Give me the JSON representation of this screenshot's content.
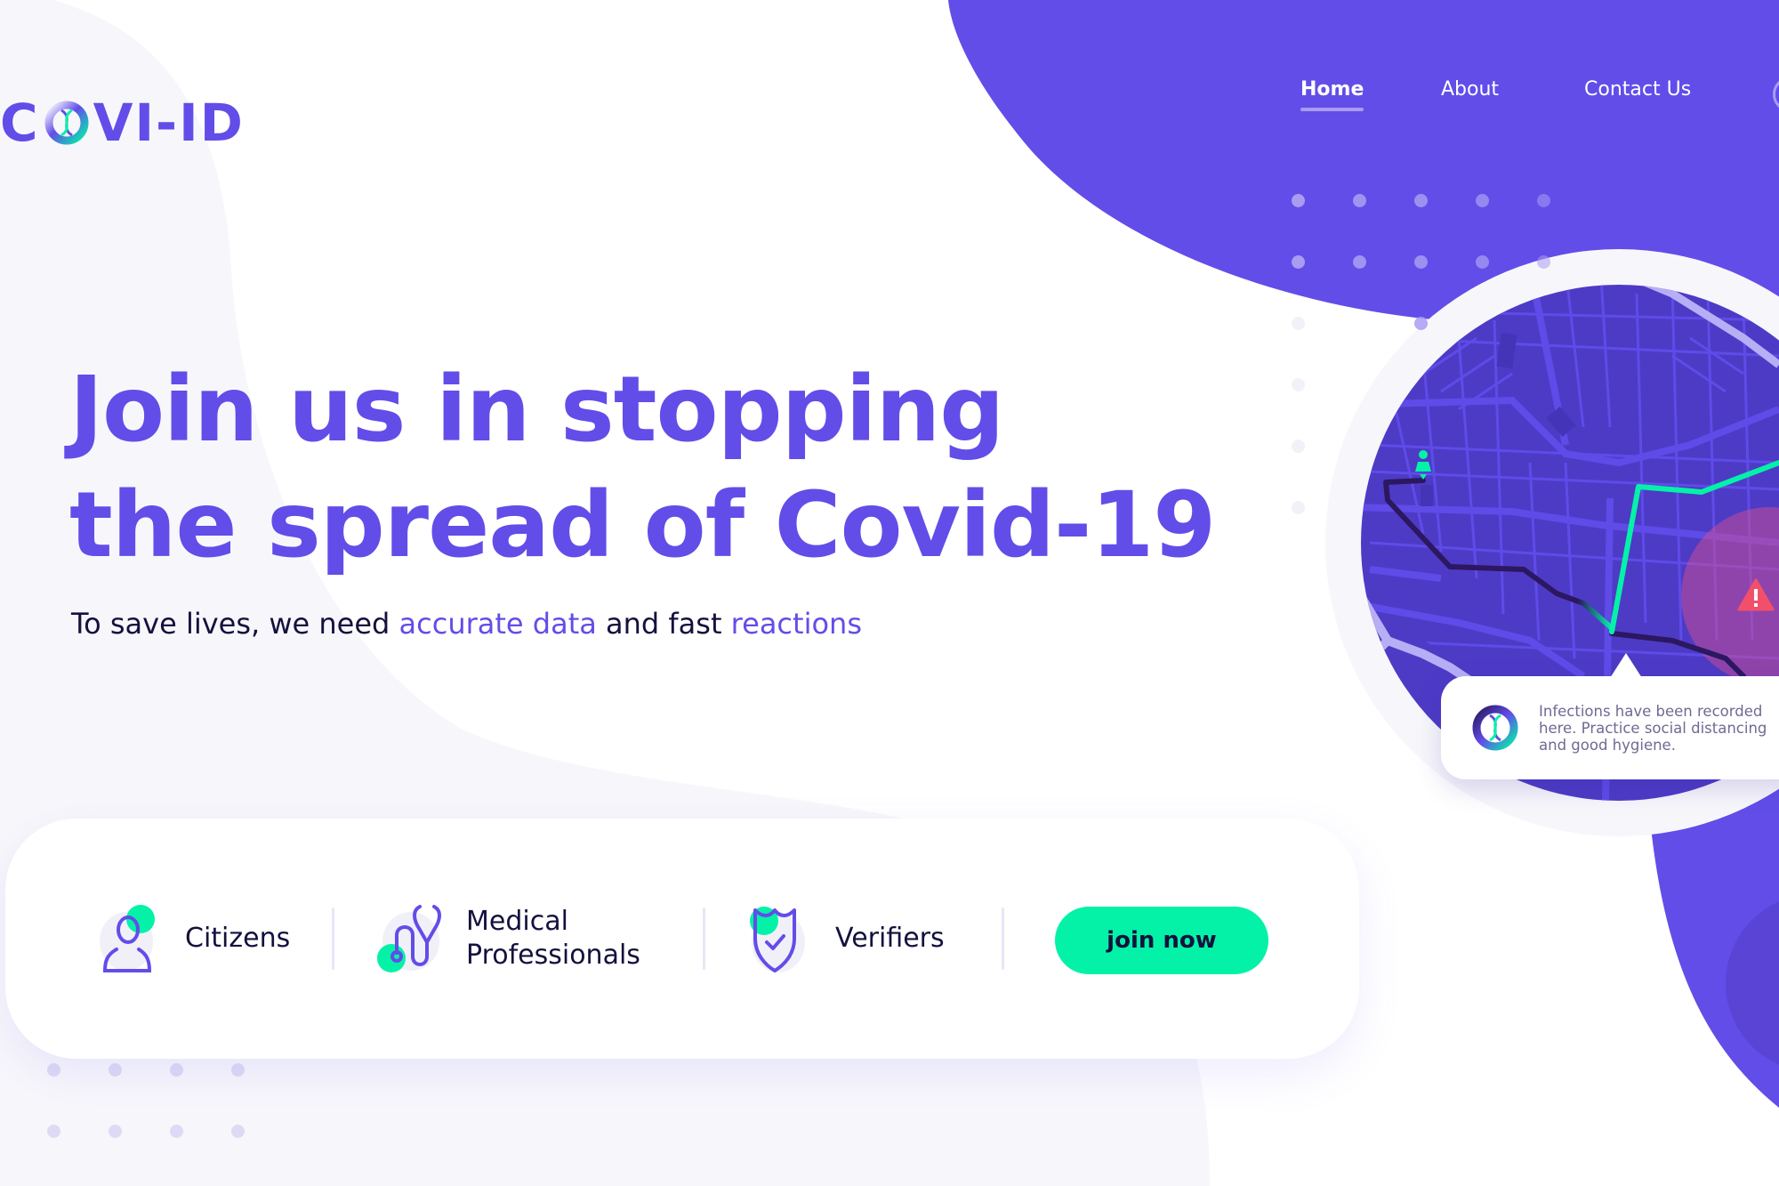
{
  "brand": {
    "name_prefix": "C",
    "name_suffix": "VI-ID",
    "logo_icon": "dna-ring-icon",
    "colors": {
      "primary": "#624de9",
      "primary_dark": "#4d3bc6",
      "accent_green": "#04f2a8",
      "text_dark": "#14113d",
      "muted_text": "#6f6a93",
      "alert_red": "#f2506a",
      "light_bg": "#f7f7fb"
    }
  },
  "nav": {
    "items": [
      {
        "label": "Home",
        "active": true
      },
      {
        "label": "About",
        "active": false
      },
      {
        "label": "Contact Us",
        "active": false
      }
    ]
  },
  "hero": {
    "title_line1": "Join us in stopping",
    "title_line2": "the spread of Covid-19",
    "subtitle": {
      "part1": "To save lives, we need ",
      "accent1": "accurate data",
      "part2": " and fast ",
      "accent2": "reactions"
    }
  },
  "roles": {
    "items": [
      {
        "label_line1": "Citizens",
        "label_line2": "",
        "icon": "person-icon"
      },
      {
        "label_line1": "Medical",
        "label_line2": "Professionals",
        "icon": "stethoscope-icon"
      },
      {
        "label_line1": "Verifiers",
        "label_line2": "",
        "icon": "shield-check-icon"
      }
    ],
    "cta_label": "join now"
  },
  "map": {
    "tooltip_text": "Infections have been recorded here. Practice social distancing and good hygiene.",
    "marker_icon": "person-marker-icon",
    "alert_icon": "warning-triangle-icon",
    "alert_glyph": "!"
  }
}
